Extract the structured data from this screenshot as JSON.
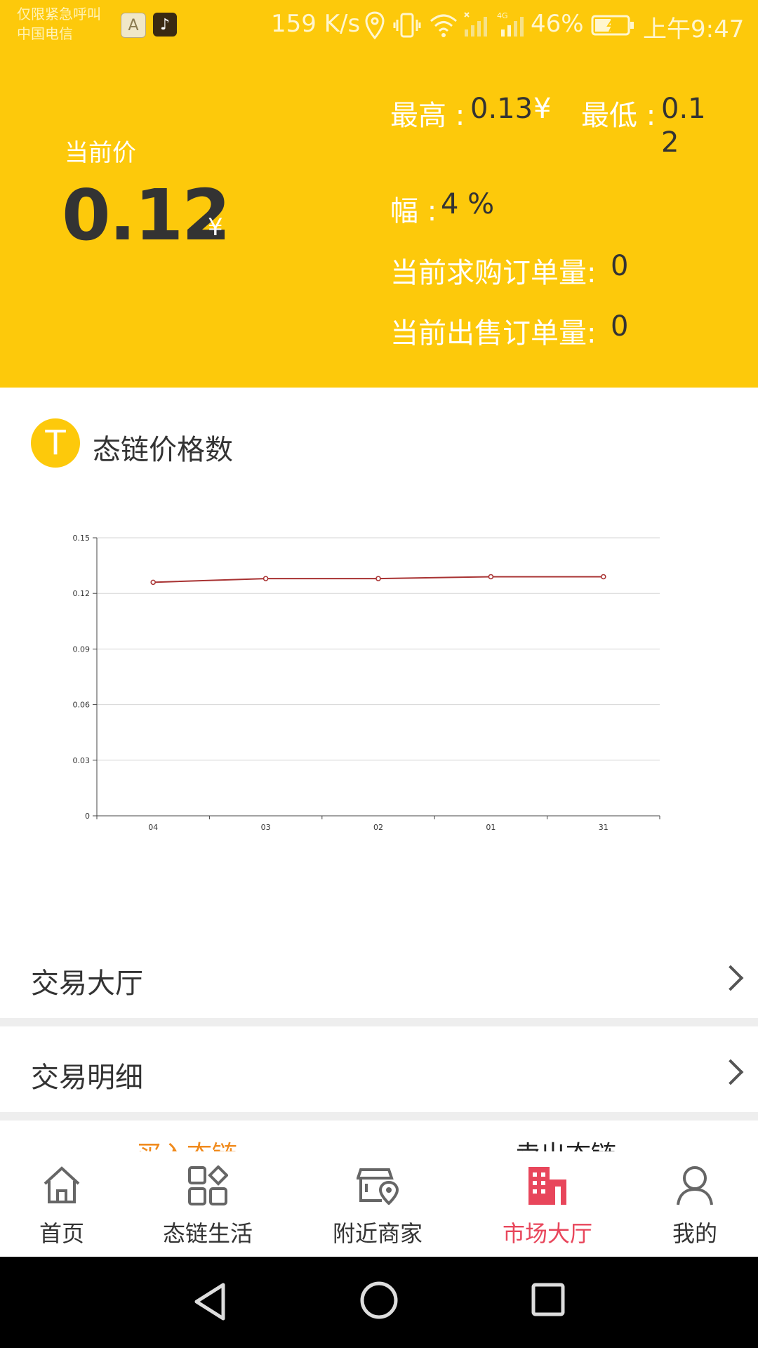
{
  "status_bar": {
    "carrier_line1": "仅限紧急呼叫",
    "carrier_line2": "中国电信",
    "app_a_label": "A",
    "speed": "159 K/s",
    "battery": "46%",
    "time": "上午9:47"
  },
  "summary": {
    "current_price_label": "当前价",
    "current_price_value": "0.12",
    "currency": "¥",
    "high_label": "最高 :",
    "high_value": "0.13",
    "low_label": "最低 :",
    "low_value_line1": "0.1",
    "low_value_line2": "2",
    "change_label": "幅 :",
    "change_value": "4 %",
    "buy_orders_label": "当前求购订单量:",
    "buy_orders_value": "0",
    "sell_orders_label": "当前出售订单量:",
    "sell_orders_value": "0"
  },
  "price_section": {
    "icon_letter": "T",
    "title": "态链价格数"
  },
  "chart_data": {
    "type": "line",
    "x": [
      "04",
      "03",
      "02",
      "01",
      "31"
    ],
    "series": [
      {
        "values": [
          0.126,
          0.128,
          0.128,
          0.129,
          0.129
        ]
      }
    ],
    "yticks": [
      "0",
      "0.03",
      "0.06",
      "0.09",
      "0.12",
      "0.15"
    ],
    "ylim": [
      0,
      0.15
    ],
    "grid": true,
    "line_color": "#a83232"
  },
  "menu": {
    "trading_hall": "交易大厅",
    "trade_details": "交易明细",
    "buy_label": "买入态链",
    "sell_label": "卖出态链"
  },
  "bottom_nav": {
    "items": [
      {
        "label": "首页",
        "icon": "home-icon"
      },
      {
        "label": "态链生活",
        "icon": "apps-icon"
      },
      {
        "label": "附近商家",
        "icon": "store-location-icon"
      },
      {
        "label": "市场大厅",
        "icon": "building-icon"
      },
      {
        "label": "我的",
        "icon": "person-icon"
      }
    ],
    "active_index": 3,
    "active_color": "#e8465b"
  },
  "colors": {
    "header_bg": "#fdc90b",
    "accent": "#fdc90b"
  }
}
